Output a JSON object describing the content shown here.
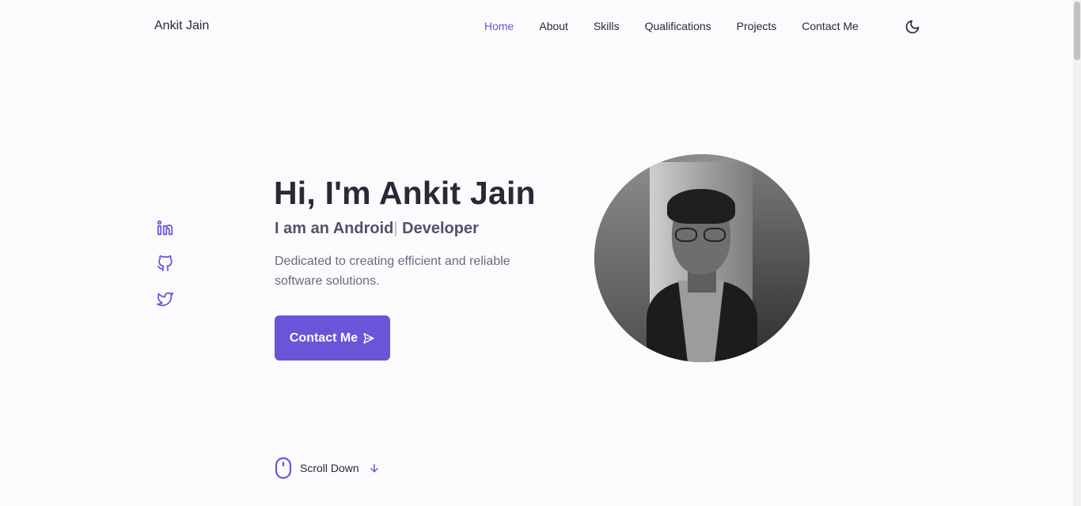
{
  "brand": "Ankit Jain",
  "nav": {
    "items": [
      {
        "label": "Home",
        "active": true
      },
      {
        "label": "About",
        "active": false
      },
      {
        "label": "Skills",
        "active": false
      },
      {
        "label": "Qualifications",
        "active": false
      },
      {
        "label": "Projects",
        "active": false
      },
      {
        "label": "Contact Me",
        "active": false
      }
    ],
    "theme_icon": "moon-icon"
  },
  "social": {
    "icons": [
      "linkedin-icon",
      "github-icon",
      "twitter-icon"
    ]
  },
  "hero": {
    "title": "Hi, I'm Ankit Jain",
    "subtitle_prefix": "I am an Android",
    "subtitle_caret": "|",
    "subtitle_suffix": " Developer",
    "description": "Dedicated to creating efficient and reliable software solutions.",
    "button_label": "Contact Me",
    "button_icon": "send-icon",
    "avatar_icon": "profile-photo"
  },
  "scroll": {
    "label": "Scroll Down",
    "mouse_icon": "mouse-icon",
    "arrow_icon": "arrow-down-icon"
  },
  "colors": {
    "accent": "#6a55d8",
    "text": "#2b2838",
    "background": "#fbfbfd"
  }
}
